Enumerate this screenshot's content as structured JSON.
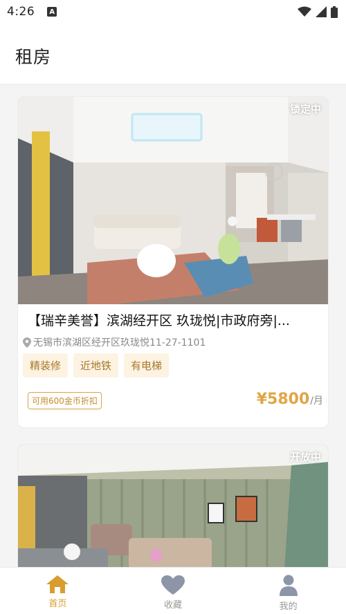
{
  "status": {
    "time": "4:26",
    "notification_icon": "app-notification-icon",
    "wifi_icon": "wifi-icon",
    "signal_icon": "signal-icon",
    "battery_icon": "battery-icon"
  },
  "header": {
    "title": "租房"
  },
  "listings": [
    {
      "status_badge": "锁定中",
      "title": "【瑞辛美誉】滨湖经开区 玖珑悦|市政府旁|...",
      "address": "无锡市滨湖区经开区玖珑悦11-27-1101",
      "tags": [
        "精装修",
        "近地铁",
        "有电梯"
      ],
      "coupon": "可用600金币折扣",
      "price": "¥5800",
      "price_unit": "/月"
    },
    {
      "status_badge": "开放中"
    }
  ],
  "tabbar": {
    "items": [
      {
        "label": "首页",
        "icon": "home-icon",
        "active": true
      },
      {
        "label": "收藏",
        "icon": "heart-icon",
        "active": false
      },
      {
        "label": "我的",
        "icon": "user-icon",
        "active": false
      }
    ]
  },
  "colors": {
    "accent": "#d79e2f",
    "price": "#e0a545",
    "tag_bg": "#fdf3e3",
    "tag_text": "#a7782a"
  }
}
